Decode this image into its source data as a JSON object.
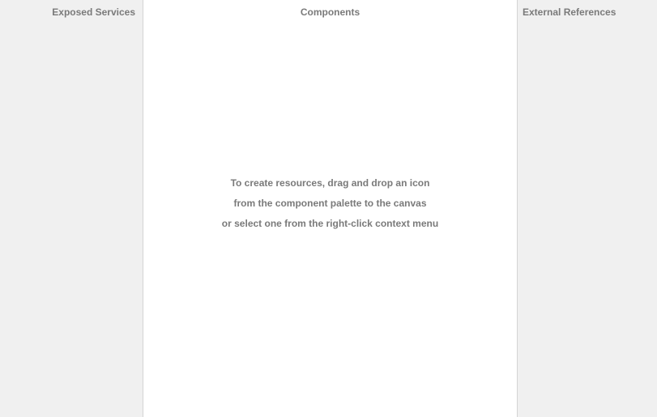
{
  "lanes": {
    "exposed_services": {
      "title": "Exposed Services"
    },
    "components": {
      "title": "Components",
      "hint_lines": [
        "To create resources, drag and drop an icon",
        "from the component palette to the canvas",
        "or select one from the right-click context menu"
      ]
    },
    "external_references": {
      "title": "External References"
    }
  },
  "colors": {
    "side_lane_background": "#f0f0f0",
    "center_lane_background": "#ffffff",
    "divider": "#d4d4d4",
    "label_text": "#7a7a7a"
  }
}
